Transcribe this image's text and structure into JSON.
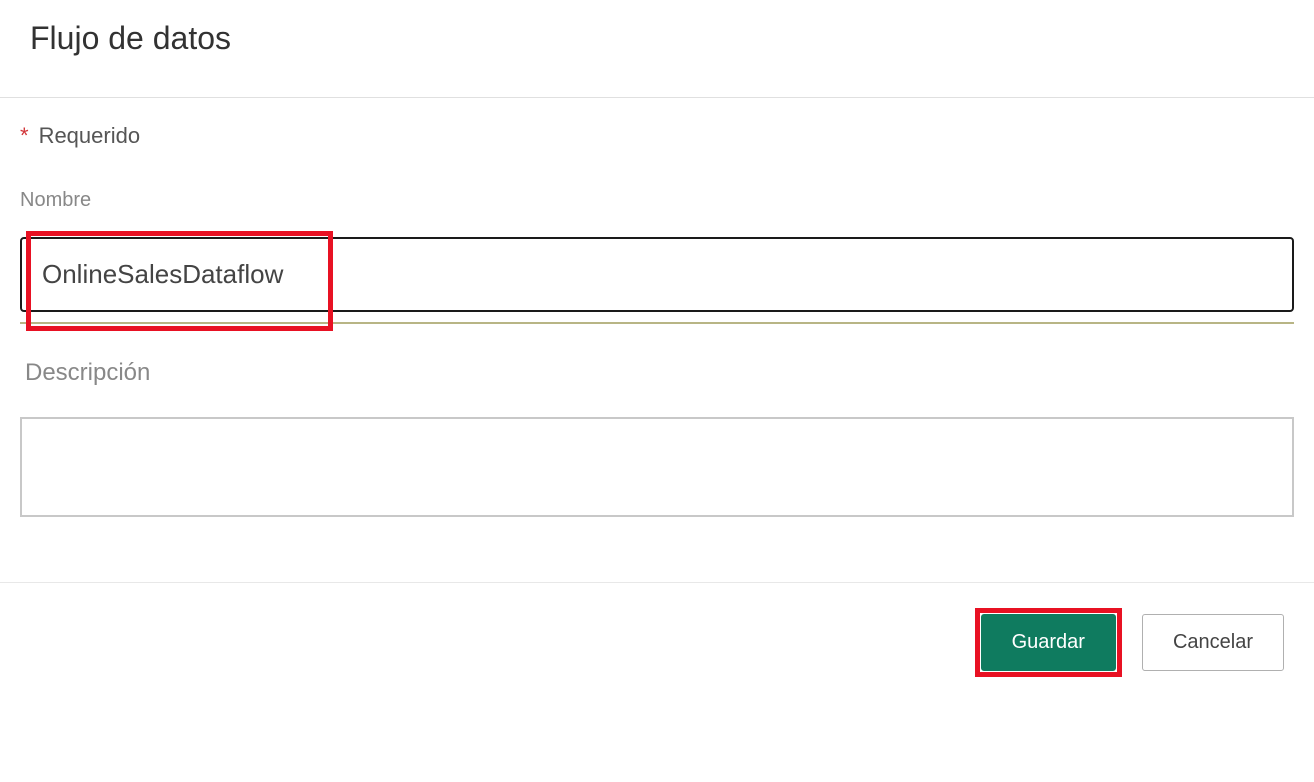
{
  "header": {
    "title": "Flujo de datos"
  },
  "form": {
    "required_indicator": "*",
    "required_label": "Requerido",
    "name_label": "Nombre",
    "name_value": "OnlineSalesDataflow",
    "description_label": "Descripción",
    "description_value": ""
  },
  "footer": {
    "save_label": "Guardar",
    "cancel_label": "Cancelar"
  }
}
